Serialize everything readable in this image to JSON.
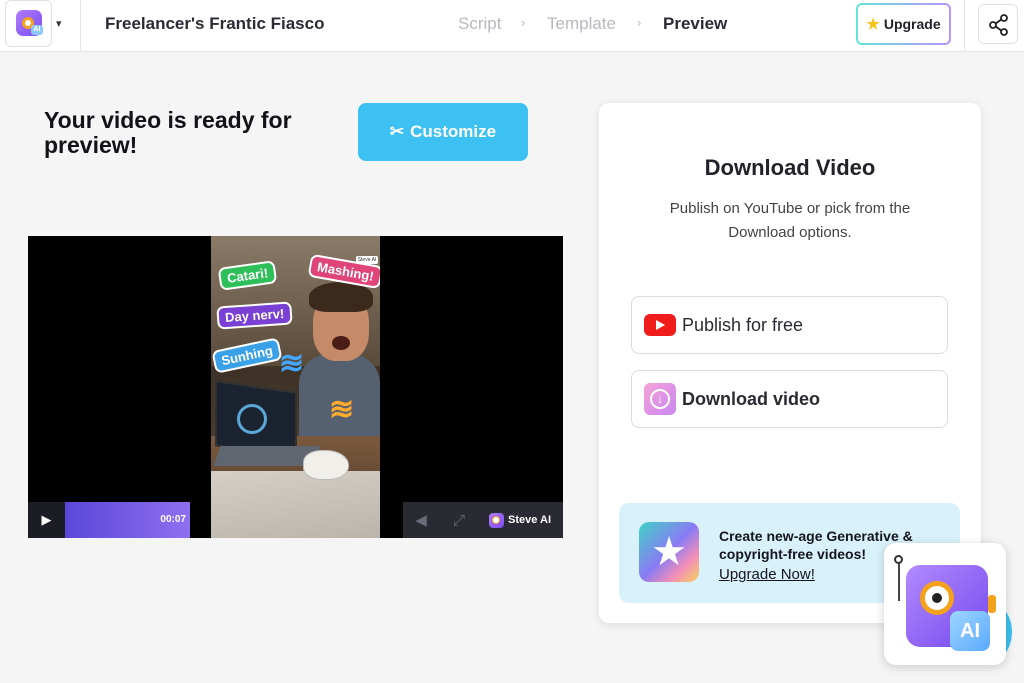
{
  "header": {
    "project_title": "Freelancer's Frantic Fiasco",
    "steps": [
      {
        "label": "Script",
        "state": "done"
      },
      {
        "label": "Template",
        "state": "done"
      },
      {
        "label": "Preview",
        "state": "active"
      }
    ],
    "upgrade_label": "Upgrade",
    "logo_badge": "AI"
  },
  "main": {
    "ready_title": "Your video is ready for preview!",
    "customize_label": "Customize"
  },
  "video": {
    "stickers": [
      "Catari!",
      "Mashing!",
      "Day nerv!",
      "Sunhing"
    ],
    "time": "00:07",
    "brand": "Steve AI",
    "frame_logo": "Steve AI"
  },
  "download_panel": {
    "title": "Download Video",
    "subtitle": "Publish on YouTube or pick from the Download options.",
    "options": [
      {
        "label": "Publish for free",
        "icon": "youtube-icon"
      },
      {
        "label": "Download video",
        "icon": "download-icon"
      }
    ],
    "promo": {
      "text": "Create new-age Generative & copyright-free videos!",
      "link": "Upgrade Now!"
    }
  },
  "assistant": {
    "badge": "AI"
  },
  "colors": {
    "accent": "#3dc1f2",
    "youtube": "#f01c1c",
    "promo_bg": "#d9f1fa",
    "progress": "#6b55e6"
  }
}
